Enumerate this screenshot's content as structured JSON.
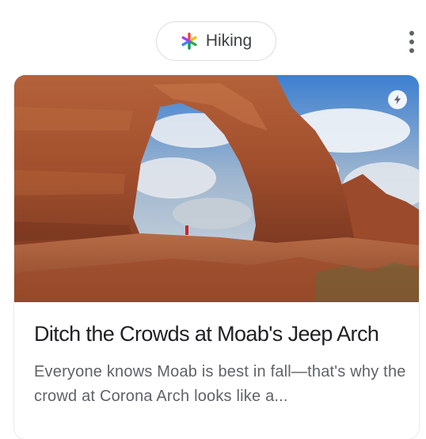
{
  "topic_chip": {
    "label": "Hiking",
    "icon": "google-multicolor-asterisk-icon"
  },
  "overflow_menu": {
    "icon": "more-vert-icon"
  },
  "card": {
    "image": "red-rock-natural-arch-photo",
    "badge_icon": "lightning-bolt-icon",
    "title": "Ditch the Crowds at Moab's Jeep Arch",
    "snippet": "Everyone knows Moab is best in fall—that's why the crowd at Corona Arch looks like a..."
  },
  "colors": {
    "chip_border": "#dadce0",
    "text_primary": "#202124",
    "text_secondary": "#5f6368"
  }
}
